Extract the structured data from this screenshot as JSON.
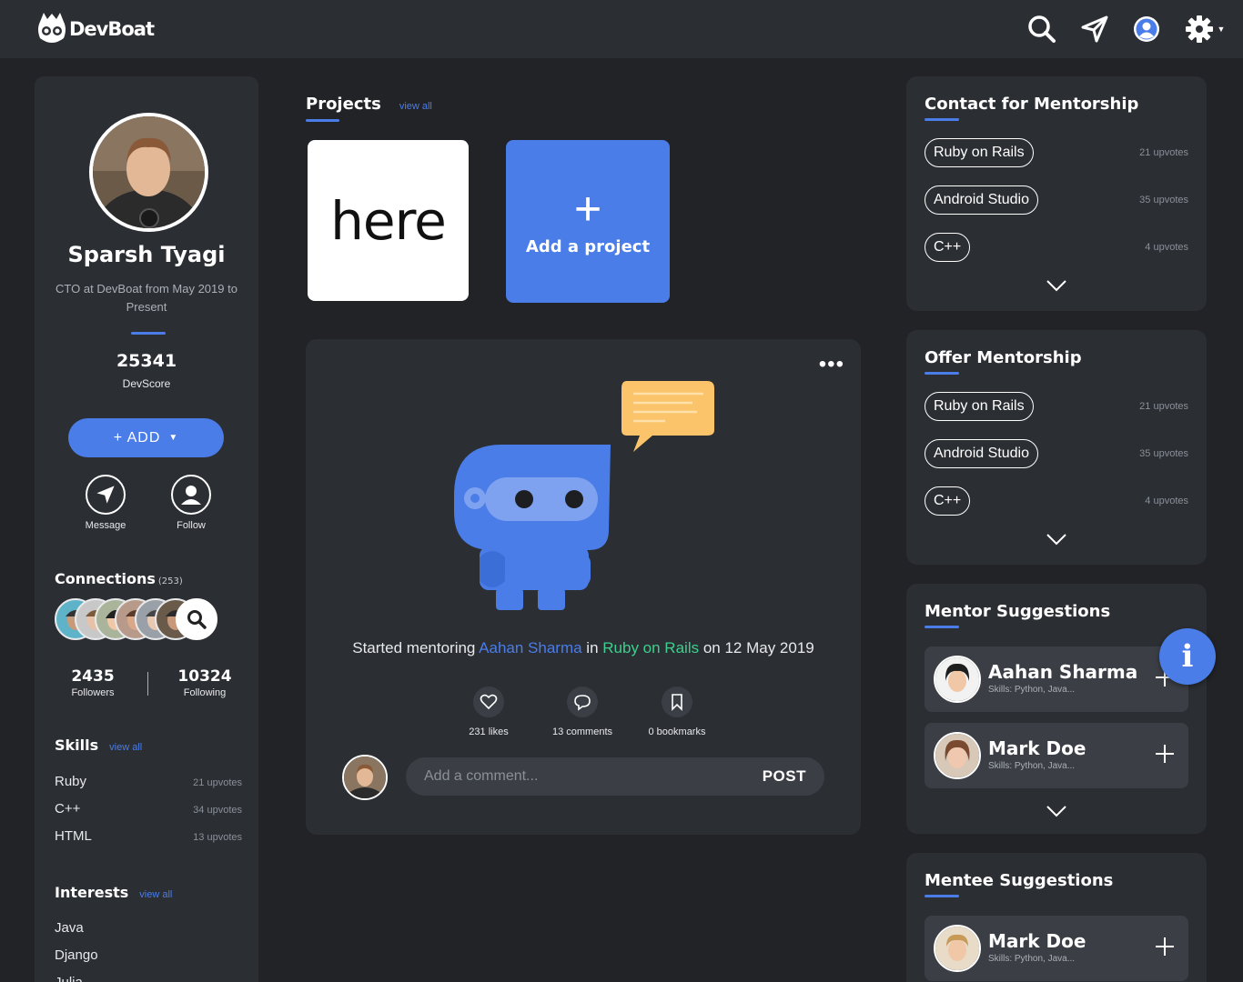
{
  "app": {
    "logo_text": "DevBoat"
  },
  "topbar": {
    "icons": [
      "search-icon",
      "send-icon",
      "profile-icon",
      "settings-icon"
    ]
  },
  "profile": {
    "name": "Sparsh Tyagi",
    "role": "CTO at DevBoat from May 2019 to Present",
    "score": "25341",
    "score_label": "DevScore",
    "add_label": "+ ADD",
    "add_caret": "▼",
    "message_label": "Message",
    "follow_label": "Follow",
    "connections_title": "Connections",
    "connections_count": "(253)",
    "followers": "2435",
    "followers_label": "Followers",
    "following": "10324",
    "following_label": "Following",
    "skills_title": "Skills",
    "skills_view_all": "view all",
    "skills": [
      {
        "name": "Ruby",
        "upvotes": "21 upvotes"
      },
      {
        "name": "C++",
        "upvotes": "34 upvotes"
      },
      {
        "name": "HTML",
        "upvotes": "13 upvotes"
      }
    ],
    "interests_title": "Interests",
    "interests_view_all": "view all",
    "interests": [
      "Java",
      "Django",
      "Julia"
    ]
  },
  "projects": {
    "title": "Projects",
    "view_all": "view all",
    "cards": [
      {
        "text": "here"
      }
    ],
    "add_label": "Add a project",
    "add_plus": "+"
  },
  "feed": {
    "more": "•••",
    "text_prefix": "Started mentoring ",
    "mentee": "Aahan Sharma",
    "text_mid": " in ",
    "topic": "Ruby on Rails",
    "text_suffix": " on 12 May 2019",
    "likes": "231 likes",
    "comments": "13 comments",
    "bookmarks": "0 bookmarks",
    "comment_placeholder": "Add a comment...",
    "post_label": "POST"
  },
  "contact_mentorship": {
    "title": "Contact for Mentorship",
    "items": [
      {
        "name": "Ruby on Rails",
        "upvotes": "21 upvotes"
      },
      {
        "name": "Android Studio",
        "upvotes": "35 upvotes"
      },
      {
        "name": "C++",
        "upvotes": "4 upvotes"
      }
    ]
  },
  "offer_mentorship": {
    "title": "Offer Mentorship",
    "items": [
      {
        "name": "Ruby on Rails",
        "upvotes": "21 upvotes"
      },
      {
        "name": "Android Studio",
        "upvotes": "35 upvotes"
      },
      {
        "name": "C++",
        "upvotes": "4 upvotes"
      }
    ]
  },
  "mentor_suggestions": {
    "title": "Mentor Suggestions",
    "people": [
      {
        "name": "Aahan Sharma",
        "skills": "Skills: Python, Java..."
      },
      {
        "name": "Mark Doe",
        "skills": "Skills: Python, Java..."
      }
    ]
  },
  "mentee_suggestions": {
    "title": "Mentee Suggestions",
    "people": [
      {
        "name": "Mark Doe",
        "skills": "Skills: Python, Java..."
      }
    ]
  },
  "info_fab": "i",
  "colors": {
    "accent": "#4a7de8",
    "green": "#3ecf8e",
    "bg": "#212327",
    "card": "#2b2e33"
  }
}
